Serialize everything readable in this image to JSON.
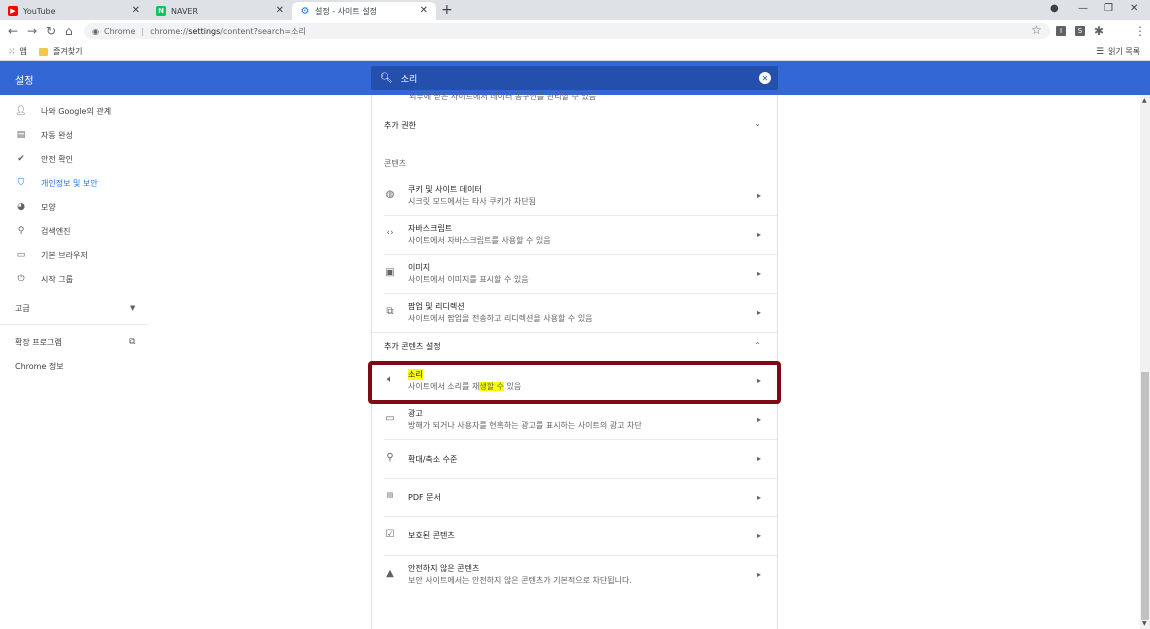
{
  "tabs": [
    {
      "title": "YouTube",
      "icon": "youtube-icon"
    },
    {
      "title": "NAVER",
      "icon": "naver-icon"
    },
    {
      "title": "설정 - 사이트 설정",
      "icon": "settings-gear-icon"
    }
  ],
  "omnibox": {
    "site_label": "Chrome",
    "url_prefix": "chrome://",
    "url_host": "settings",
    "url_path": "/content?search=소리"
  },
  "bookmarks": {
    "apps_label": "앱",
    "folder_label": "즐겨찾기",
    "reading_list_label": "읽기 목록"
  },
  "header": {
    "title": "설정",
    "search_value": "소리"
  },
  "sidebar": {
    "items": [
      {
        "label": "나와 Google의 관계",
        "icon": "person-icon"
      },
      {
        "label": "자동 완성",
        "icon": "clipboard-icon"
      },
      {
        "label": "안전 확인",
        "icon": "shield-check-icon"
      },
      {
        "label": "개인정보 및 보안",
        "icon": "shield-icon"
      },
      {
        "label": "모양",
        "icon": "palette-icon"
      },
      {
        "label": "검색엔진",
        "icon": "search-icon"
      },
      {
        "label": "기본 브라우저",
        "icon": "browser-icon"
      },
      {
        "label": "시작 그룹",
        "icon": "power-icon"
      }
    ],
    "advanced_label": "고급",
    "extensions_label": "확장 프로그램",
    "about_label": "Chrome 정보"
  },
  "content": {
    "cut_text": "외부에 받은 사이트에서 데이터 동구인를 관리할 수 있음",
    "additional_permissions": "추가 권한",
    "section_title": "콘텐츠",
    "rows_a": [
      {
        "title": "쿠키 및 사이트 데이터",
        "desc": "시크릿 모드에서는 타사 쿠키가 차단됨",
        "icon": "cookie-icon"
      },
      {
        "title": "자바스크립트",
        "desc": "사이트에서 자바스크립트를 사용할 수 있음",
        "icon": "code-icon"
      },
      {
        "title": "이미지",
        "desc": "사이트에서 이미지를 표시할 수 있음",
        "icon": "image-icon"
      },
      {
        "title": "팝업 및 리디렉션",
        "desc": "사이트에서 팝업을 전송하고 리디렉션을 사용할 수 있음",
        "icon": "external-link-icon"
      }
    ],
    "additional_content_settings": "추가 콘텐츠 설정",
    "sound": {
      "title": "소리",
      "desc_before": "사이트에서 소리를 재",
      "desc_highlight": "생할 수",
      "desc_after": " 있음"
    },
    "rows_b": [
      {
        "title": "광고",
        "desc": "방해가 되거나 사용자를 현혹하는 광고를 표시하는 사이트의 광고 차단",
        "icon": "ads-icon"
      },
      {
        "title": "확대/축소 수준",
        "desc": "",
        "icon": "zoom-icon"
      },
      {
        "title": "PDF 문서",
        "desc": "",
        "icon": "pdf-icon"
      },
      {
        "title": "보호된 콘텐츠",
        "desc": "",
        "icon": "protected-content-icon"
      },
      {
        "title": "안전하지 않은 콘텐츠",
        "desc": "보안 사이트에서는 안전하지 않은 콘텐츠가 기본적으로 차단됩니다.",
        "icon": "warning-icon"
      }
    ]
  },
  "colors": {
    "header_blue": "#3367d6",
    "search_blue": "#254fad",
    "active_blue": "#1a73e8",
    "highlight": "#ffff00",
    "annotation_red": "#7f0a16"
  }
}
